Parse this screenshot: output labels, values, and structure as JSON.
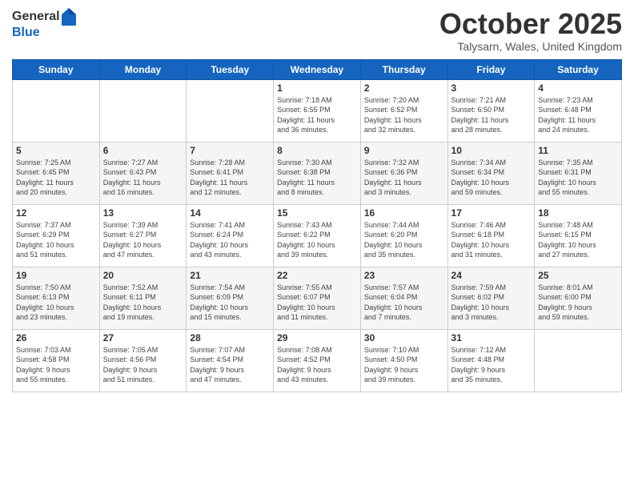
{
  "header": {
    "logo_general": "General",
    "logo_blue": "Blue",
    "month_title": "October 2025",
    "location": "Talysarn, Wales, United Kingdom"
  },
  "days_of_week": [
    "Sunday",
    "Monday",
    "Tuesday",
    "Wednesday",
    "Thursday",
    "Friday",
    "Saturday"
  ],
  "weeks": [
    [
      {
        "day": "",
        "info": ""
      },
      {
        "day": "",
        "info": ""
      },
      {
        "day": "",
        "info": ""
      },
      {
        "day": "1",
        "info": "Sunrise: 7:18 AM\nSunset: 6:55 PM\nDaylight: 11 hours\nand 36 minutes."
      },
      {
        "day": "2",
        "info": "Sunrise: 7:20 AM\nSunset: 6:52 PM\nDaylight: 11 hours\nand 32 minutes."
      },
      {
        "day": "3",
        "info": "Sunrise: 7:21 AM\nSunset: 6:50 PM\nDaylight: 11 hours\nand 28 minutes."
      },
      {
        "day": "4",
        "info": "Sunrise: 7:23 AM\nSunset: 6:48 PM\nDaylight: 11 hours\nand 24 minutes."
      }
    ],
    [
      {
        "day": "5",
        "info": "Sunrise: 7:25 AM\nSunset: 6:45 PM\nDaylight: 11 hours\nand 20 minutes."
      },
      {
        "day": "6",
        "info": "Sunrise: 7:27 AM\nSunset: 6:43 PM\nDaylight: 11 hours\nand 16 minutes."
      },
      {
        "day": "7",
        "info": "Sunrise: 7:28 AM\nSunset: 6:41 PM\nDaylight: 11 hours\nand 12 minutes."
      },
      {
        "day": "8",
        "info": "Sunrise: 7:30 AM\nSunset: 6:38 PM\nDaylight: 11 hours\nand 8 minutes."
      },
      {
        "day": "9",
        "info": "Sunrise: 7:32 AM\nSunset: 6:36 PM\nDaylight: 11 hours\nand 3 minutes."
      },
      {
        "day": "10",
        "info": "Sunrise: 7:34 AM\nSunset: 6:34 PM\nDaylight: 10 hours\nand 59 minutes."
      },
      {
        "day": "11",
        "info": "Sunrise: 7:35 AM\nSunset: 6:31 PM\nDaylight: 10 hours\nand 55 minutes."
      }
    ],
    [
      {
        "day": "12",
        "info": "Sunrise: 7:37 AM\nSunset: 6:29 PM\nDaylight: 10 hours\nand 51 minutes."
      },
      {
        "day": "13",
        "info": "Sunrise: 7:39 AM\nSunset: 6:27 PM\nDaylight: 10 hours\nand 47 minutes."
      },
      {
        "day": "14",
        "info": "Sunrise: 7:41 AM\nSunset: 6:24 PM\nDaylight: 10 hours\nand 43 minutes."
      },
      {
        "day": "15",
        "info": "Sunrise: 7:43 AM\nSunset: 6:22 PM\nDaylight: 10 hours\nand 39 minutes."
      },
      {
        "day": "16",
        "info": "Sunrise: 7:44 AM\nSunset: 6:20 PM\nDaylight: 10 hours\nand 35 minutes."
      },
      {
        "day": "17",
        "info": "Sunrise: 7:46 AM\nSunset: 6:18 PM\nDaylight: 10 hours\nand 31 minutes."
      },
      {
        "day": "18",
        "info": "Sunrise: 7:48 AM\nSunset: 6:15 PM\nDaylight: 10 hours\nand 27 minutes."
      }
    ],
    [
      {
        "day": "19",
        "info": "Sunrise: 7:50 AM\nSunset: 6:13 PM\nDaylight: 10 hours\nand 23 minutes."
      },
      {
        "day": "20",
        "info": "Sunrise: 7:52 AM\nSunset: 6:11 PM\nDaylight: 10 hours\nand 19 minutes."
      },
      {
        "day": "21",
        "info": "Sunrise: 7:54 AM\nSunset: 6:09 PM\nDaylight: 10 hours\nand 15 minutes."
      },
      {
        "day": "22",
        "info": "Sunrise: 7:55 AM\nSunset: 6:07 PM\nDaylight: 10 hours\nand 11 minutes."
      },
      {
        "day": "23",
        "info": "Sunrise: 7:57 AM\nSunset: 6:04 PM\nDaylight: 10 hours\nand 7 minutes."
      },
      {
        "day": "24",
        "info": "Sunrise: 7:59 AM\nSunset: 6:02 PM\nDaylight: 10 hours\nand 3 minutes."
      },
      {
        "day": "25",
        "info": "Sunrise: 8:01 AM\nSunset: 6:00 PM\nDaylight: 9 hours\nand 59 minutes."
      }
    ],
    [
      {
        "day": "26",
        "info": "Sunrise: 7:03 AM\nSunset: 4:58 PM\nDaylight: 9 hours\nand 55 minutes."
      },
      {
        "day": "27",
        "info": "Sunrise: 7:05 AM\nSunset: 4:56 PM\nDaylight: 9 hours\nand 51 minutes."
      },
      {
        "day": "28",
        "info": "Sunrise: 7:07 AM\nSunset: 4:54 PM\nDaylight: 9 hours\nand 47 minutes."
      },
      {
        "day": "29",
        "info": "Sunrise: 7:08 AM\nSunset: 4:52 PM\nDaylight: 9 hours\nand 43 minutes."
      },
      {
        "day": "30",
        "info": "Sunrise: 7:10 AM\nSunset: 4:50 PM\nDaylight: 9 hours\nand 39 minutes."
      },
      {
        "day": "31",
        "info": "Sunrise: 7:12 AM\nSunset: 4:48 PM\nDaylight: 9 hours\nand 35 minutes."
      },
      {
        "day": "",
        "info": ""
      }
    ]
  ]
}
